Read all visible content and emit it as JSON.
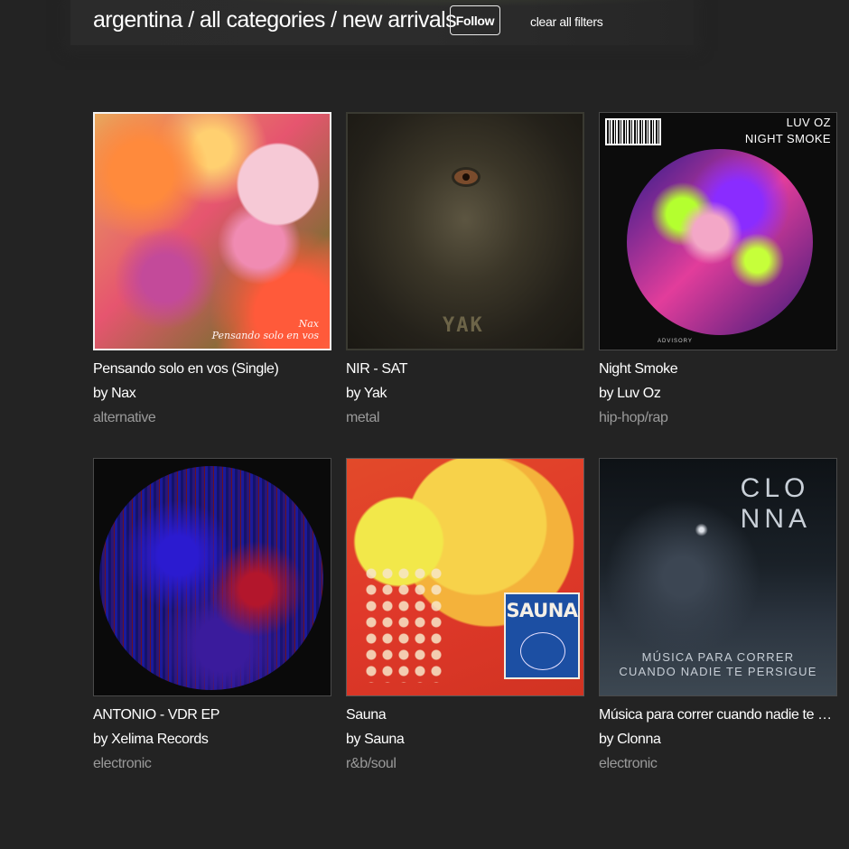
{
  "header": {
    "breadcrumb": "argentina / all categories / new arrivals",
    "follow_label": "Follow",
    "clear_label": "clear all filters"
  },
  "releases": [
    {
      "title": "Pensando solo en vos (Single)",
      "artist": "by Nax",
      "genre": "alternative",
      "art_text": [
        "Nax",
        "Pensando solo en vos"
      ]
    },
    {
      "title": "NIR - SAT",
      "artist": "by Yak",
      "genre": "metal",
      "art_text": [
        "YAK"
      ]
    },
    {
      "title": "Night Smoke",
      "artist": "by Luv Oz",
      "genre": "hip-hop/rap",
      "art_text": [
        "LUV OZ",
        "NIGHT SMOKE",
        "ADVISORY"
      ]
    },
    {
      "title": "ANTONIO - VDR EP",
      "artist": "by Xelima Records",
      "genre": "electronic",
      "art_text": []
    },
    {
      "title": "Sauna",
      "artist": "by Sauna",
      "genre": "r&b/soul",
      "art_text": [
        "SAUNA"
      ]
    },
    {
      "title": "Música para correr cuando nadie te p…",
      "artist": "by Clonna",
      "genre": "electronic",
      "art_text": [
        "CLO",
        "NNA",
        "MÚSICA PARA CORRER",
        "CUANDO NADIE TE PERSIGUE"
      ]
    }
  ]
}
